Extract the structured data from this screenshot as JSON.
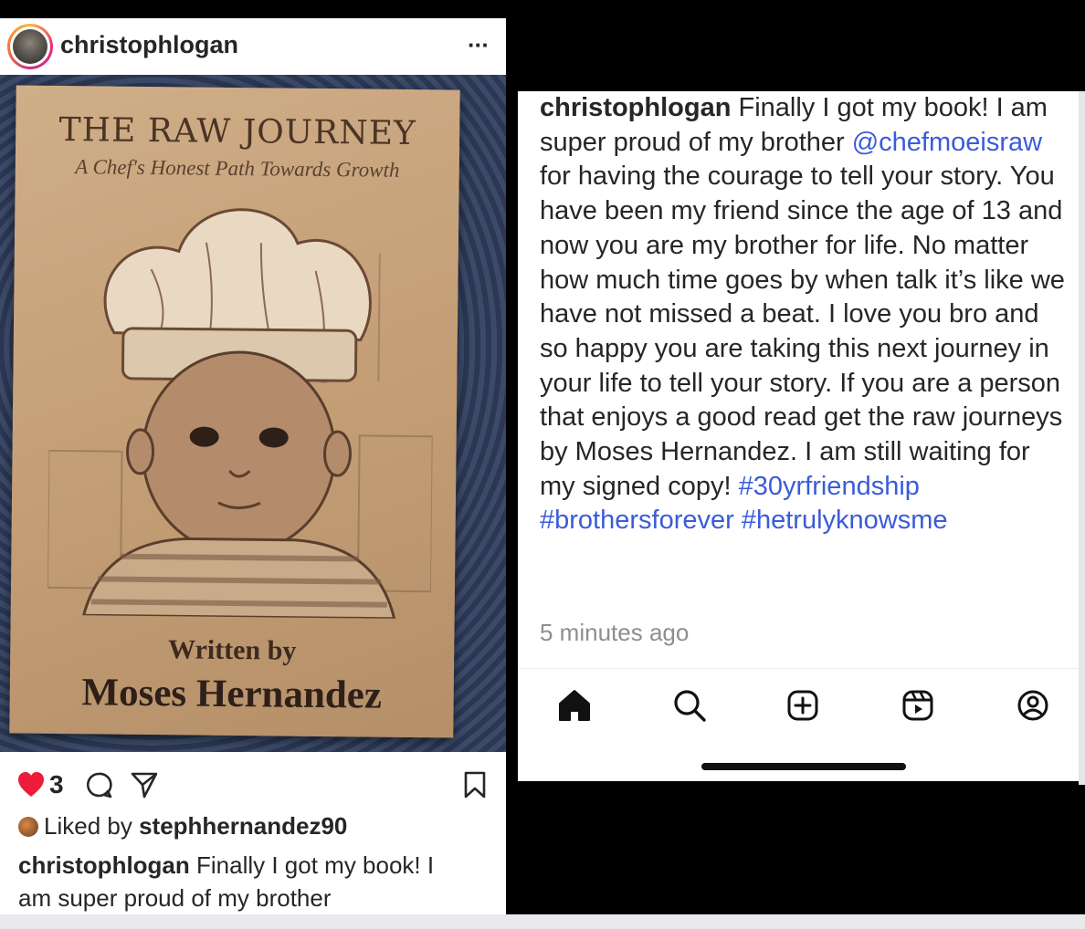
{
  "left_post": {
    "username": "christophlogan",
    "more_label": "···",
    "book": {
      "title": "THE RAW JOURNEY",
      "subtitle": "A Chef's Honest Path Towards Growth",
      "written_by": "Written by",
      "author": "Moses Hernandez"
    },
    "likes_count": "3",
    "liked_by_prefix": "Liked by ",
    "liked_by_user": "stephhernandez90",
    "caption_user": "christophlogan",
    "caption_preview_line1": " Finally I got my book! I",
    "caption_preview_line2": "am super proud of my brother"
  },
  "right_post": {
    "caption_user": "christophlogan",
    "caption_text_1": " Finally I got my book! I am super proud of my brother ",
    "mention": "@chefmoeisraw",
    "caption_text_2": " for having the courage to tell your story. You have been my friend since the age of 13 and now you are my brother for life. No matter how much time goes by when talk it’s like we have not missed a beat. I love you bro and so happy you are taking this next journey in your life to tell your story. If you are a person that enjoys a good read get the raw journeys by Moses Hernandez. I am still waiting for my signed copy! ",
    "hashtag_1": "#30yrfriendship",
    "hashtag_2": "#brothersforever",
    "hashtag_3": "#hetrulyknowsme",
    "timestamp": "5 minutes ago"
  },
  "bottom_nav": {
    "items": [
      "home-icon",
      "search-icon",
      "create-icon",
      "reels-icon",
      "profile-icon"
    ]
  },
  "colors": {
    "link_blue": "#3b5bdb",
    "heart_red": "#ed1c3b",
    "text_dark": "#262626",
    "muted_gray": "#8e8e8e"
  }
}
